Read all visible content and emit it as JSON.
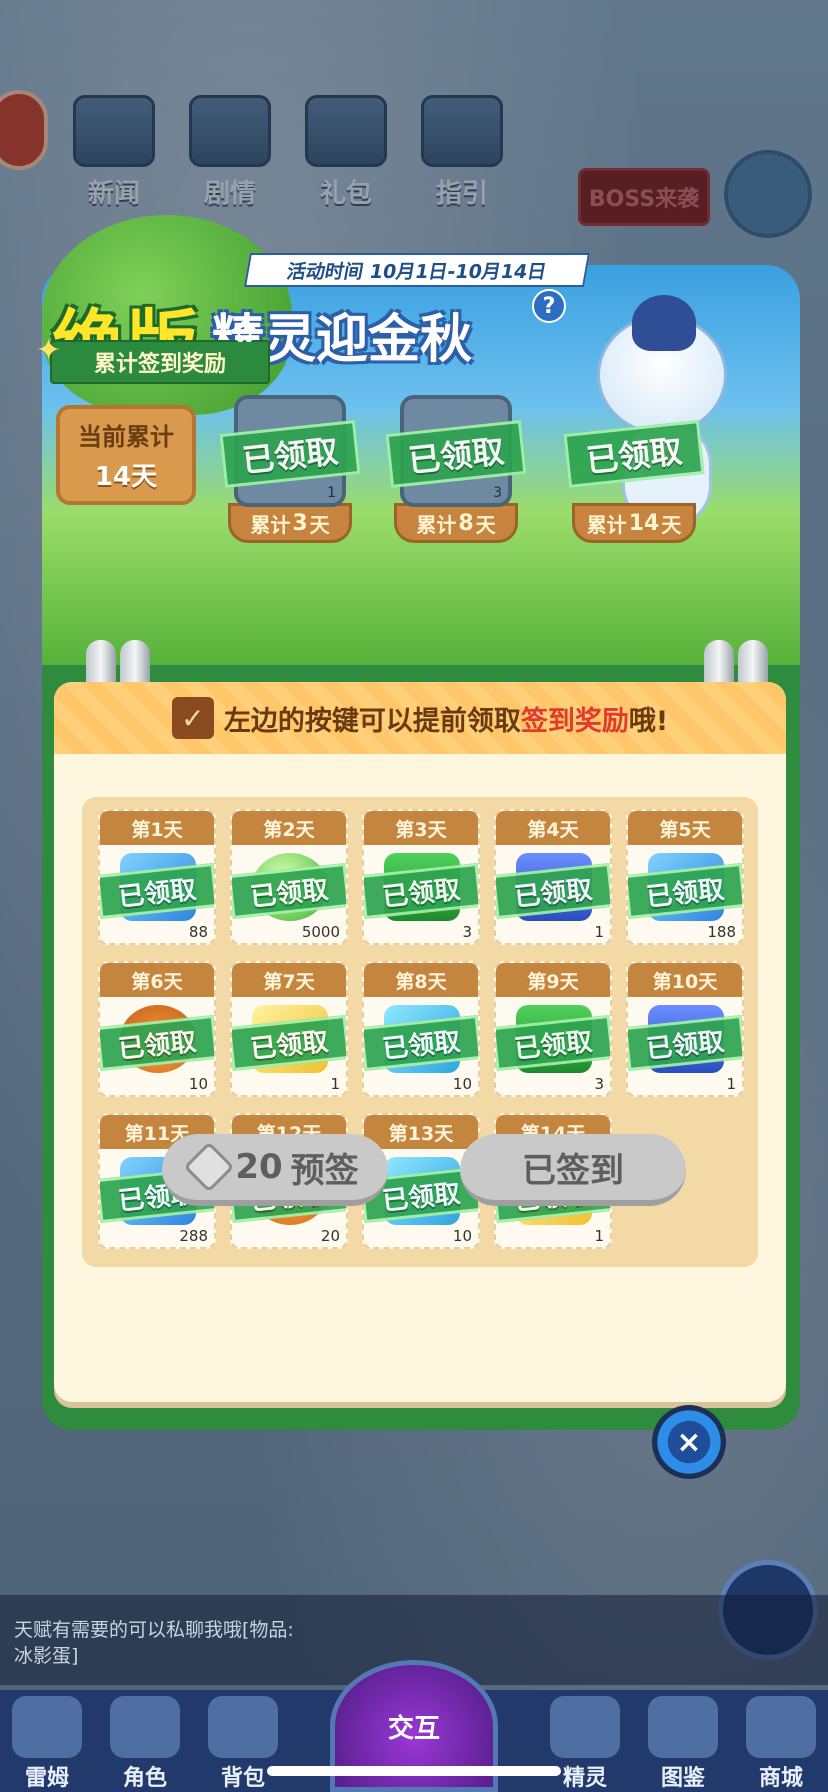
{
  "top_nav": [
    {
      "label": "新闻"
    },
    {
      "label": "剧情"
    },
    {
      "label": "礼包"
    },
    {
      "label": "指引"
    }
  ],
  "boss_label": "BOSS来袭",
  "banner": {
    "period": "活动时间 10月1日-10月14日",
    "title_main": "绝版",
    "title_sub": "精灵迎金秋",
    "help": "?",
    "ribbon": "累计签到奖励",
    "total_label": "当前累计",
    "total_value": "14天",
    "milestones": [
      {
        "prefix": "累计",
        "days": "3",
        "suffix": "天",
        "count": "1",
        "status": "已领取"
      },
      {
        "prefix": "累计",
        "days": "8",
        "suffix": "天",
        "count": "3",
        "status": "已领取"
      },
      {
        "prefix": "累计",
        "days": "14",
        "suffix": "天",
        "count": "",
        "status": "已领取"
      }
    ]
  },
  "notebook": {
    "tip_part1": "左边的按键可以提前领取",
    "tip_highlight": "签到奖励",
    "tip_part2": "哦!",
    "days": [
      {
        "label": "第1天",
        "count": "88",
        "status": "已领取",
        "item": "blue-crystal"
      },
      {
        "label": "第2天",
        "count": "5000",
        "status": "已领取",
        "item": "green-orb"
      },
      {
        "label": "第3天",
        "count": "3",
        "status": "已领取",
        "item": "green-chest"
      },
      {
        "label": "第4天",
        "count": "1",
        "status": "已领取",
        "item": "blue-chest"
      },
      {
        "label": "第5天",
        "count": "188",
        "status": "已领取",
        "item": "blue-crystal"
      },
      {
        "label": "第6天",
        "count": "10",
        "status": "已领取",
        "item": "potion-jar"
      },
      {
        "label": "第7天",
        "count": "1",
        "status": "已领取",
        "item": "yellow-gem"
      },
      {
        "label": "第8天",
        "count": "10",
        "status": "已领取",
        "item": "blue-heart"
      },
      {
        "label": "第9天",
        "count": "3",
        "status": "已领取",
        "item": "green-chest"
      },
      {
        "label": "第10天",
        "count": "1",
        "status": "已领取",
        "item": "blue-chest"
      },
      {
        "label": "第11天",
        "count": "288",
        "status": "已领取",
        "item": "blue-crystal"
      },
      {
        "label": "第12天",
        "count": "20",
        "status": "已领取",
        "item": "potion-jar"
      },
      {
        "label": "第13天",
        "count": "10",
        "status": "已领取",
        "item": "blue-heart"
      },
      {
        "label": "第14天",
        "count": "1",
        "status": "已领取",
        "item": "yellow-gem"
      }
    ],
    "presign_cost": "20",
    "presign_label": "预签",
    "signed_label": "已签到"
  },
  "close_icon": "close-icon",
  "chat": {
    "line1": "天赋有需要的可以私聊我哦[物品:",
    "line2": "冰影蛋]"
  },
  "bottom_nav": [
    {
      "label": "雷姆"
    },
    {
      "label": "角色"
    },
    {
      "label": "背包"
    },
    {
      "label": "交互"
    },
    {
      "label": "精灵"
    },
    {
      "label": "图鉴"
    },
    {
      "label": "商城"
    }
  ],
  "colors": {
    "claimed_green": "#2ea44f",
    "highlight_red": "#e23b2e",
    "title_yellow": "#ffe629"
  }
}
